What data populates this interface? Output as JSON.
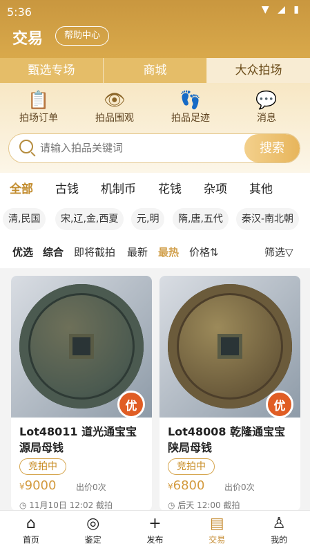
{
  "status_bar": {
    "time": "5:36",
    "icons": "▼ ◢ ▮"
  },
  "header": {
    "title": "交易",
    "help": "帮助中心"
  },
  "tabs": [
    {
      "label": "甄选专场"
    },
    {
      "label": "商城"
    },
    {
      "label": "大众拍场"
    }
  ],
  "quick_actions": [
    {
      "label": "拍场订单",
      "icon": "📋"
    },
    {
      "label": "拍品围观",
      "icon": "👁"
    },
    {
      "label": "拍品足迹",
      "icon": "👣"
    },
    {
      "label": "消息",
      "icon": "💬"
    }
  ],
  "search": {
    "placeholder": "请输入拍品关键词",
    "button": "搜索"
  },
  "categories": [
    {
      "label": "全部"
    },
    {
      "label": "古钱"
    },
    {
      "label": "机制币"
    },
    {
      "label": "花钱"
    },
    {
      "label": "杂项"
    },
    {
      "label": "其他"
    }
  ],
  "dynasties": [
    {
      "label": "清,民国"
    },
    {
      "label": "宋,辽,金,西夏"
    },
    {
      "label": "元,明"
    },
    {
      "label": "隋,唐,五代"
    },
    {
      "label": "秦汉-南北朝"
    }
  ],
  "sorts": [
    {
      "label": "优选"
    },
    {
      "label": "综合"
    },
    {
      "label": "即将截拍"
    },
    {
      "label": "最新"
    },
    {
      "label": "最热"
    },
    {
      "label": "价格⇅"
    },
    {
      "label": "筛选▽"
    }
  ],
  "lots": [
    {
      "title": "Lot48011  道光通宝宝源局母钱",
      "status": "竞拍中",
      "price_symbol": "¥",
      "price": "9000",
      "bids": "出价0次",
      "time": "◷ 11月10日 12:02 截拍",
      "badge": "优",
      "coin_colors": [
        "#4b5a50",
        "#6e7059",
        "#2e3a35"
      ]
    },
    {
      "title": "Lot48008  乾隆通宝宝陕局母钱",
      "status": "竞拍中",
      "price_symbol": "¥",
      "price": "6800",
      "bids": "出价0次",
      "time": "◷ 后天 12:00 截拍",
      "badge": "优",
      "coin_colors": [
        "#6b5b3b",
        "#9c8a5a",
        "#4c3e2a"
      ]
    }
  ],
  "bottom_nav": [
    {
      "label": "首页",
      "icon": "⌂"
    },
    {
      "label": "鉴定",
      "icon": "◎"
    },
    {
      "label": "发布",
      "icon": "+"
    },
    {
      "label": "交易",
      "icon": "▤"
    },
    {
      "label": "我的",
      "icon": "♙"
    }
  ],
  "colors": {
    "primary": "#c9973f",
    "accent": "#e05d24"
  }
}
